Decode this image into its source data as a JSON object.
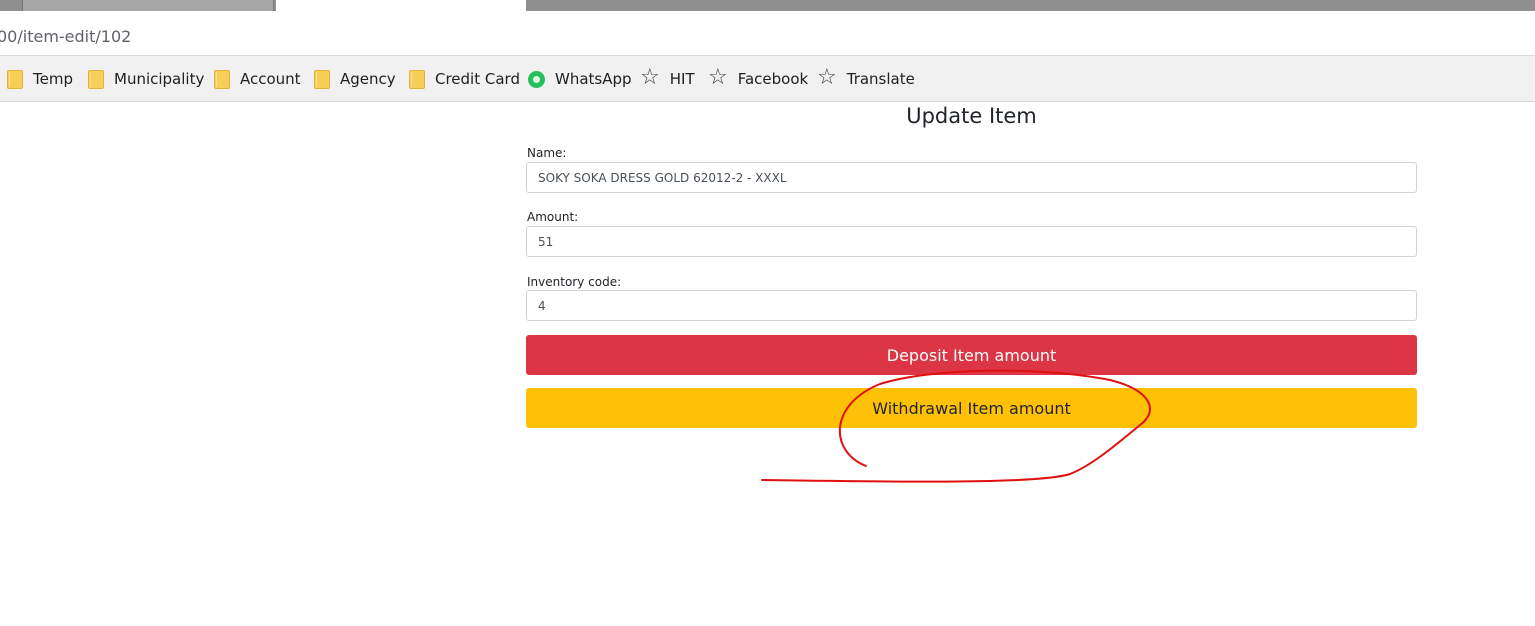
{
  "browser": {
    "url": "00/item-edit/102",
    "bookmarks": [
      {
        "label": "Temp",
        "icon": "folder-icon"
      },
      {
        "label": "Municipality",
        "icon": "folder-icon"
      },
      {
        "label": "Account",
        "icon": "folder-icon"
      },
      {
        "label": "Agency",
        "icon": "folder-icon"
      },
      {
        "label": "Credit Card",
        "icon": "folder-icon"
      },
      {
        "label": "WhatsApp",
        "icon": "whatsapp-icon"
      },
      {
        "label": "HIT",
        "icon": "star-icon"
      },
      {
        "label": "Facebook",
        "icon": "star-icon"
      },
      {
        "label": "Translate",
        "icon": "star-icon"
      }
    ]
  },
  "form": {
    "title": "Update Item",
    "name_label": "Name:",
    "name_value": "SOKY SOKA DRESS GOLD 62012-2 - XXXL",
    "amount_label": "Amount:",
    "amount_value": "51",
    "inventory_label": "Inventory code:",
    "inventory_value": "4",
    "deposit_button": "Deposit Item amount",
    "withdrawal_button": "Withdrawal Item amount"
  },
  "colors": {
    "deposit": "#dc3545",
    "withdrawal": "#ffc107",
    "annotation": "#e01010"
  }
}
